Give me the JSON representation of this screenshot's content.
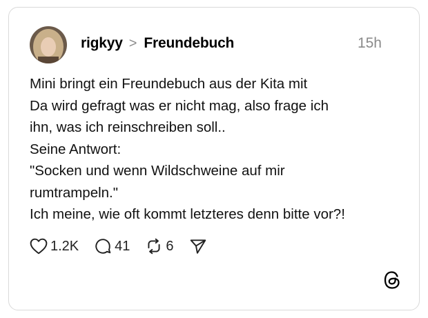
{
  "post": {
    "author": "rigkyy",
    "separator": ">",
    "topic": "Freundebuch",
    "time": "15h",
    "lines": [
      "Mini bringt ein Freundebuch aus der Kita mit",
      "Da wird gefragt was er nicht mag, also frage ich",
      "ihn, was ich reinschreiben soll..",
      "Seine Antwort:",
      "\"Socken und wenn Wildschweine auf mir",
      "rumtrampeln.\"",
      "Ich meine, wie oft kommt letzteres denn bitte vor?!"
    ]
  },
  "actions": {
    "likes": "1.2K",
    "comments": "41",
    "reposts": "6"
  },
  "icons": {
    "like": "heart-icon",
    "comment": "comment-bubble-icon",
    "repost": "repost-icon",
    "share": "send-icon",
    "brand": "threads-logo-icon"
  }
}
